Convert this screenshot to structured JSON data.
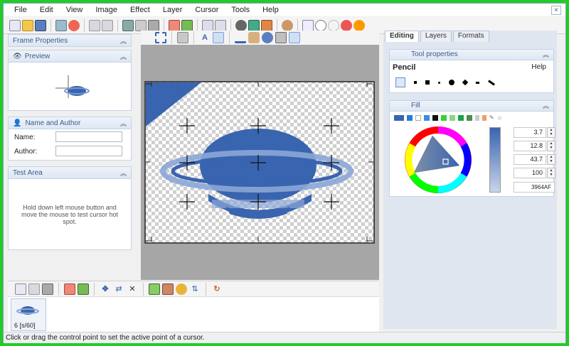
{
  "menu": [
    "File",
    "Edit",
    "View",
    "Image",
    "Effect",
    "Layer",
    "Cursor",
    "Tools",
    "Help"
  ],
  "window": {
    "close_label": "×"
  },
  "left_panel": {
    "frame_properties": "Frame Properties",
    "preview": "Preview",
    "name_and_author": "Name and Author",
    "name_label": "Name:",
    "author_label": "Author:",
    "test_area": "Test Area",
    "test_area_text": "Hold down left mouse button and move the mouse to test cursor hot spot."
  },
  "right_panel": {
    "tabs": [
      "Editing",
      "Layers",
      "Formats"
    ],
    "tool_properties": "Tool properties",
    "tool_name": "Pencil",
    "help_label": "Help",
    "fill_label": "Fill",
    "values": [
      "3.7",
      "12.8",
      "43.7",
      "100",
      "3964AF"
    ]
  },
  "frames": {
    "label": "6 [s/60]"
  },
  "status_text": "Click or drag the control point to set the active point of a cursor.",
  "colors": {
    "accent": "#3964AF",
    "window_frame": "#22cc22",
    "canvas_bg": "#a6a6a6"
  },
  "icons": [
    "new-icon",
    "open-icon",
    "save-icon",
    "undo-icon",
    "redo-icon",
    "select-icon",
    "pencil-icon",
    "line-icon",
    "fill-icon",
    "hotspot-icon",
    "help-icon"
  ]
}
